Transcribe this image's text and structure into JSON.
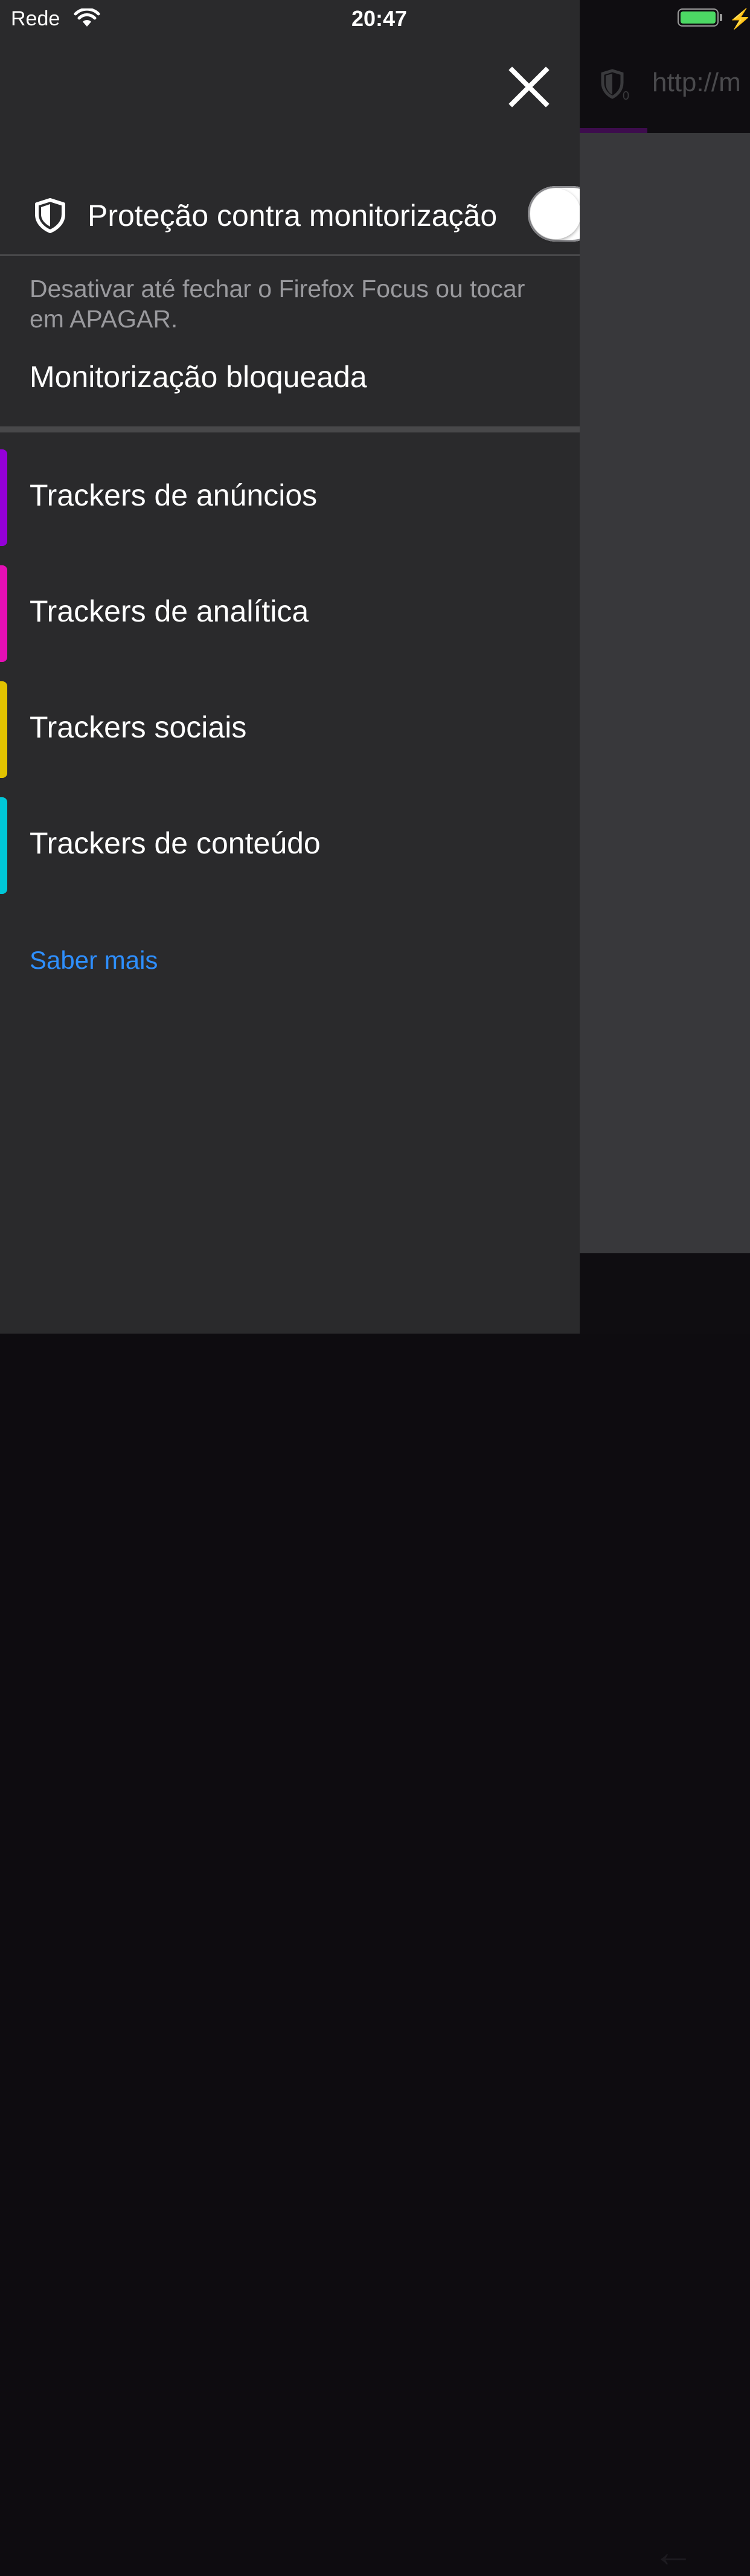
{
  "status_bar": {
    "carrier": "Rede",
    "time": "20:47"
  },
  "background": {
    "url": "http://m",
    "tracker_count": "0"
  },
  "drawer": {
    "tracking_protection_label": "Proteção contra monitorização",
    "tracking_protection_enabled": true,
    "description": "Desativar até fechar o Firefox Focus ou tocar em APAGAR.",
    "blocked_title": "Monitorização bloqueada",
    "trackers": [
      {
        "label": "Trackers de anúncios",
        "color": "#9400d8"
      },
      {
        "label": "Trackers de analítica",
        "color": "#e50fb5"
      },
      {
        "label": "Trackers sociais",
        "color": "#e2c300"
      },
      {
        "label": "Trackers de conteúdo",
        "color": "#00c7d8"
      }
    ],
    "learn_more": "Saber mais"
  },
  "colors": {
    "accent_link": "#2e8fff",
    "battery": "#4cd964"
  },
  "icons": [
    "wifi-icon",
    "battery-icon",
    "charging-bolt-icon",
    "close-icon",
    "shield-icon"
  ]
}
